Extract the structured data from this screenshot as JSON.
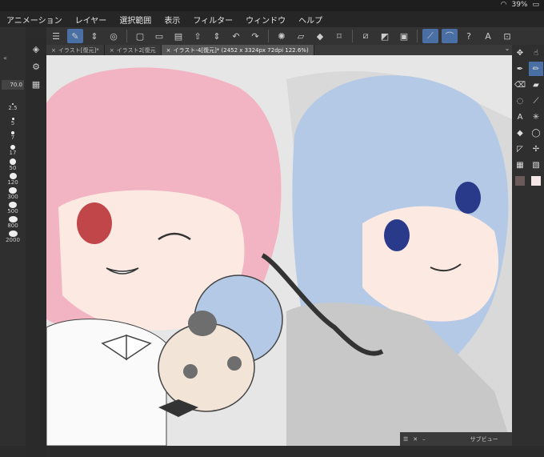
{
  "status": {
    "battery": "39%"
  },
  "menubar": [
    "アニメーション",
    "レイヤー",
    "選択範囲",
    "表示",
    "フィルター",
    "ウィンドウ",
    "ヘルプ"
  ],
  "tabs": [
    {
      "label": "イラスト[復元]*",
      "active": false
    },
    {
      "label": "イラスト2[復元",
      "active": false
    },
    {
      "label": "イラスト-4[復元]* (2452 x 3324px 72dpi 122.6%)",
      "active": true
    }
  ],
  "left": {
    "brush_size_value": "70.0",
    "brush_sizes": [
      "2.5",
      "5",
      "7",
      "17",
      "50",
      "120",
      "300",
      "500",
      "800",
      "2000"
    ]
  },
  "subview": {
    "title": "サブビュー"
  },
  "colors": {
    "pink_hair": "#f2b4c2",
    "blue_hair": "#b4c9e6",
    "accent": "#4a6fa5"
  }
}
